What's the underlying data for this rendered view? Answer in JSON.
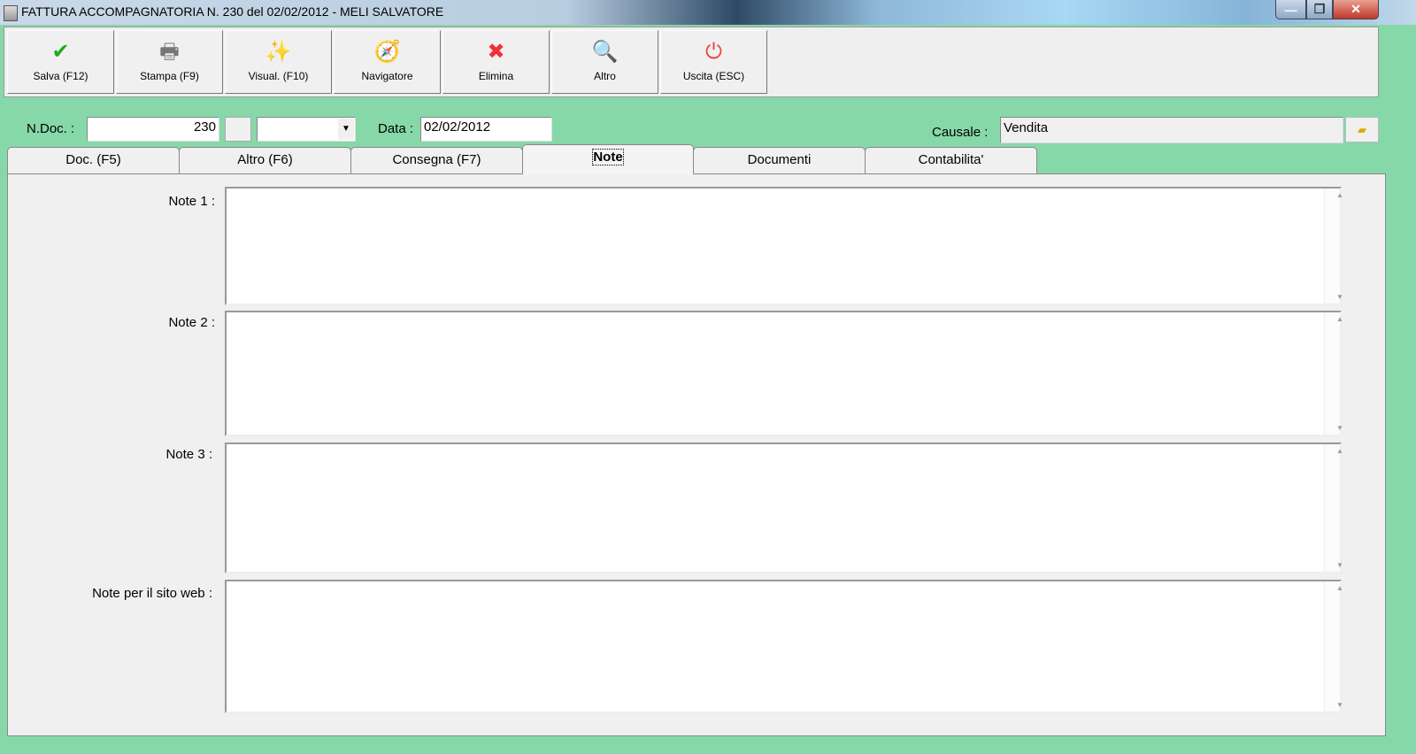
{
  "window": {
    "title": "FATTURA ACCOMPAGNATORIA N. 230  del 02/02/2012 - MELI SALVATORE",
    "minimize": "—",
    "restore": "❐",
    "close": "✕"
  },
  "toolbar": [
    {
      "label": "Salva (F12)",
      "icon": "✔"
    },
    {
      "label": "Stampa (F9)",
      "icon": "🖶"
    },
    {
      "label": "Visual. (F10)",
      "icon": "✨"
    },
    {
      "label": "Navigatore",
      "icon": "🧭"
    },
    {
      "label": "Elimina",
      "icon": "✖"
    },
    {
      "label": "Altro",
      "icon": "🔍"
    },
    {
      "label": "Uscita (ESC)",
      "icon": "⏻"
    }
  ],
  "header": {
    "ndoc_label": "N.Doc. :",
    "ndoc_value": "230",
    "data_label": "Data :",
    "data_value": "02/02/2012",
    "causale_label": "Causale :",
    "causale_value": "Vendita",
    "combo_arrow": "▼"
  },
  "tabs": [
    {
      "label": "Doc. (F5)"
    },
    {
      "label": "Altro (F6)"
    },
    {
      "label": "Consegna (F7)"
    },
    {
      "label": "Note"
    },
    {
      "label": "Documenti"
    },
    {
      "label": "Contabilita'"
    }
  ],
  "notes": [
    {
      "label": "Note 1 :",
      "value": ""
    },
    {
      "label": "Note 2 :",
      "value": ""
    },
    {
      "label": "Note 3 :",
      "value": ""
    },
    {
      "label": "Note per il sito web :",
      "value": ""
    }
  ],
  "colors": {
    "background": "#86d8a8",
    "panel": "#f0f0f0"
  }
}
